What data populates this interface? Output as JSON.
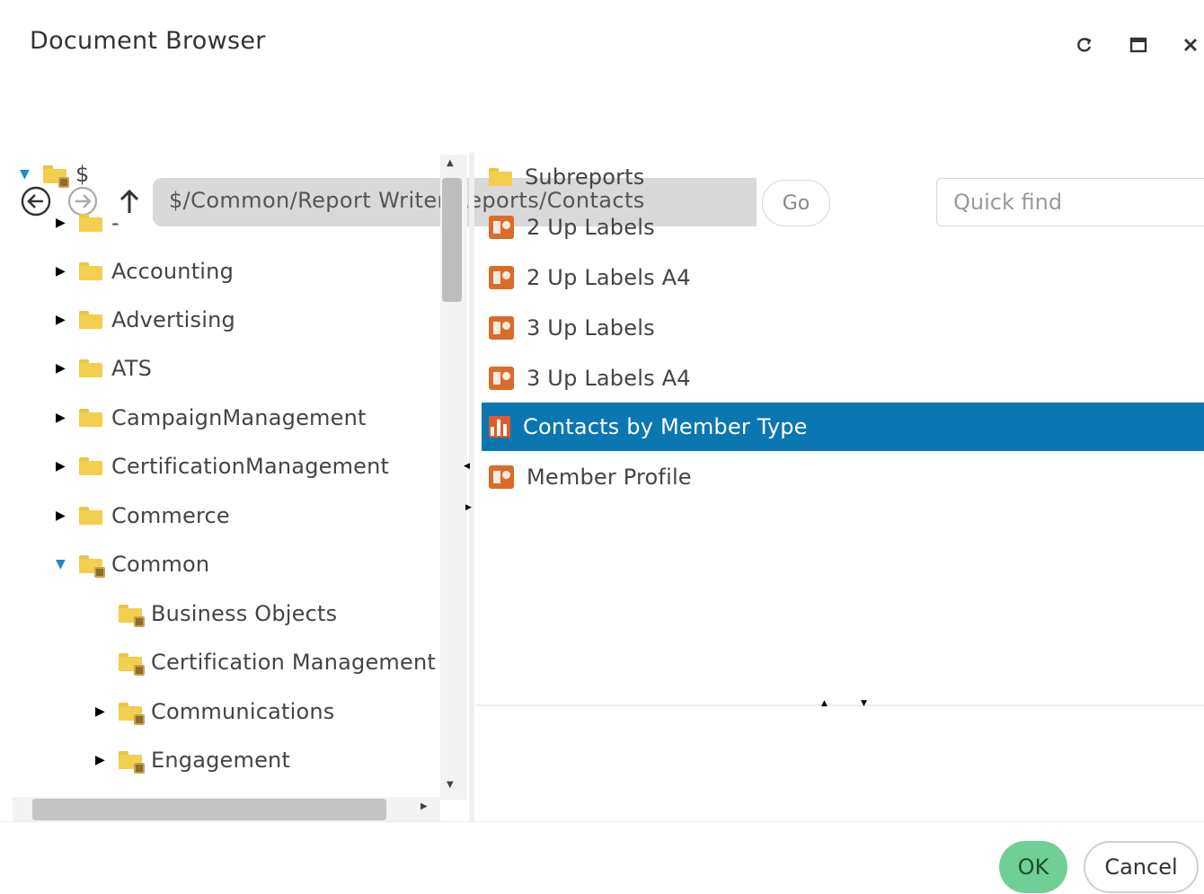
{
  "window": {
    "title": "Document Browser",
    "refresh_icon": "refresh-icon",
    "maximize_icon": "maximize-icon",
    "close_icon": "close-icon"
  },
  "toolbar": {
    "back_icon": "arrow-left-circle-icon",
    "forward_icon": "arrow-right-circle-icon",
    "up_icon": "arrow-up-icon",
    "path": "$/Common/Report Writer/Reports/Contacts",
    "go_label": "Go",
    "quick_find_placeholder": "Quick find"
  },
  "tree": {
    "items": [
      {
        "label": "$",
        "expanded": true,
        "locked": true
      },
      {
        "label": "-",
        "expanded": false,
        "locked": false
      },
      {
        "label": "Accounting",
        "expanded": false,
        "locked": false
      },
      {
        "label": "Advertising",
        "expanded": false,
        "locked": false
      },
      {
        "label": "ATS",
        "expanded": false,
        "locked": false
      },
      {
        "label": "CampaignManagement",
        "expanded": false,
        "locked": false
      },
      {
        "label": "CertificationManagement",
        "expanded": false,
        "locked": false
      },
      {
        "label": "Commerce",
        "expanded": false,
        "locked": false
      },
      {
        "label": "Common",
        "expanded": true,
        "locked": true
      },
      {
        "label": "Business Objects",
        "expanded": null,
        "locked": true
      },
      {
        "label": "Certification Management",
        "expanded": null,
        "locked": true
      },
      {
        "label": "Communications",
        "expanded": false,
        "locked": true
      },
      {
        "label": "Engagement",
        "expanded": false,
        "locked": true
      }
    ]
  },
  "list": {
    "items": [
      {
        "label": "Subreports",
        "type": "folder",
        "selected": false
      },
      {
        "label": "2 Up Labels",
        "type": "report",
        "selected": false
      },
      {
        "label": "2 Up Labels A4",
        "type": "report",
        "selected": false
      },
      {
        "label": "3 Up Labels",
        "type": "report",
        "selected": false
      },
      {
        "label": "3 Up Labels A4",
        "type": "report",
        "selected": false
      },
      {
        "label": "Contacts by Member Type",
        "type": "chart",
        "selected": true
      },
      {
        "label": "Member Profile",
        "type": "report",
        "selected": false
      }
    ]
  },
  "footer": {
    "ok_label": "OK",
    "cancel_label": "Cancel"
  },
  "colors": {
    "selection": "#0a77b2",
    "ok_button": "#6fcf97",
    "folder": "#f2cf4e",
    "report_icon": "#d96c2a"
  }
}
